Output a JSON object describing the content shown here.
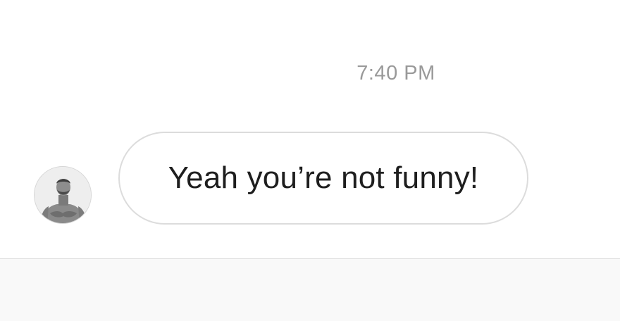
{
  "conversation": {
    "timestamp": "7:40 PM",
    "messages": [
      {
        "sender": "other",
        "text": "Yeah you’re not funny!"
      }
    ]
  },
  "colors": {
    "timestamp": "#999999",
    "bubble_border": "#dcdcdc",
    "bubble_text": "#1e1e1e",
    "composer_background": "#f9f9f9"
  },
  "icons": {
    "avatar": "avatar-photo"
  }
}
